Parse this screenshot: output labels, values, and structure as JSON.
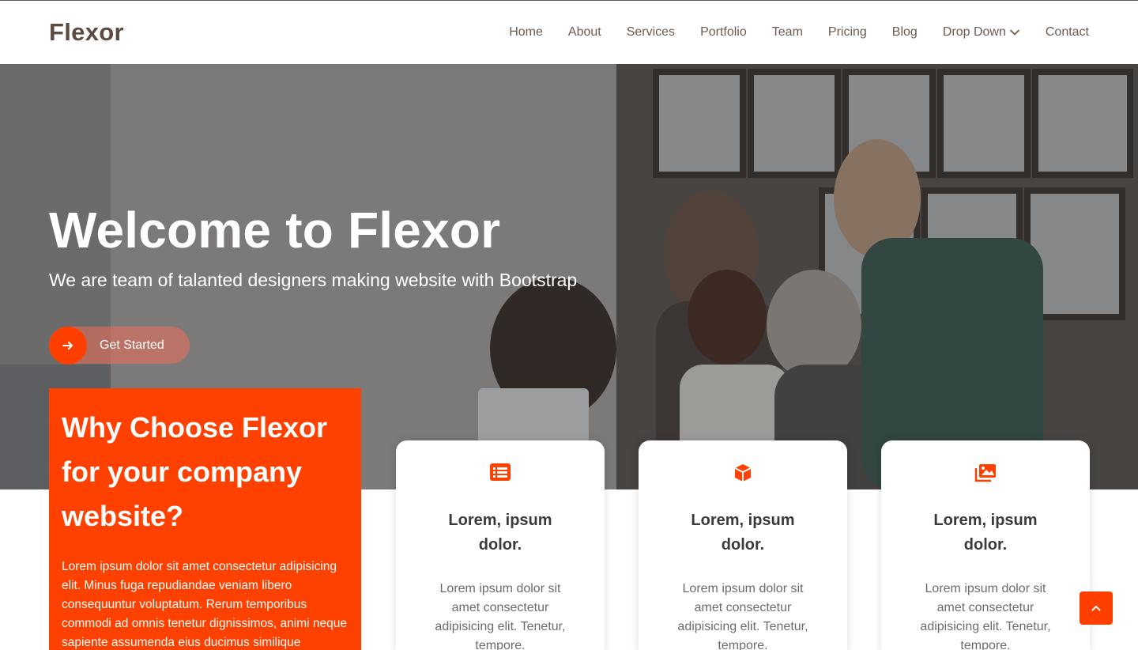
{
  "brand": {
    "logo": "Flexor",
    "accent": "#fe4100"
  },
  "nav": {
    "items": [
      "Home",
      "About",
      "Services",
      "Portfolio",
      "Team",
      "Pricing",
      "Blog",
      "Drop Down",
      "Contact"
    ],
    "dropdown_icon": "chevron-down-icon"
  },
  "hero": {
    "title": "Welcome to Flexor",
    "subtitle": "We are team of talanted designers making website with Bootstrap",
    "cta_label": "Get Started",
    "cta_icon": "arrow-right-icon"
  },
  "why": {
    "title": "Why Choose Flexor for your company website?",
    "text": "Lorem ipsum dolor sit amet consectetur adipisicing elit. Minus fuga repudiandae veniam libero consequuntur voluptatum. Rerum temporibus commodi ad omnis tenetur dignissimos, animi neque sapiente assumenda eius ducimus similique"
  },
  "cards": [
    {
      "icon": "list-icon",
      "title": "Lorem, ipsum dolor.",
      "text": "Lorem ipsum dolor sit amet consectetur adipisicing elit. Tenetur, tempore."
    },
    {
      "icon": "cube-icon",
      "title": "Lorem, ipsum dolor.",
      "text": "Lorem ipsum dolor sit amet consectetur adipisicing elit. Tenetur, tempore."
    },
    {
      "icon": "images-icon",
      "title": "Lorem, ipsum dolor.",
      "text": "Lorem ipsum dolor sit amet consectetur adipisicing elit. Tenetur, tempore."
    }
  ],
  "scroll_top_icon": "chevron-up-icon"
}
